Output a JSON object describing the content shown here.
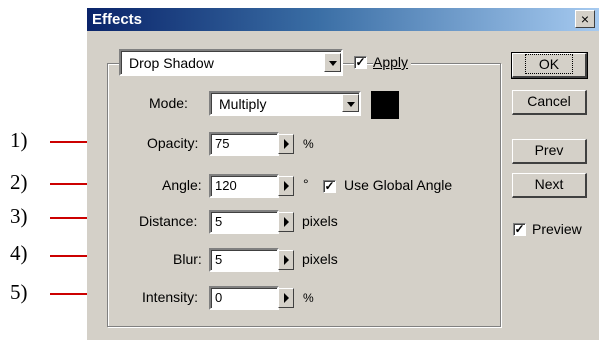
{
  "window": {
    "title": "Effects",
    "close_glyph": "×"
  },
  "effect": {
    "selected": "Drop Shadow",
    "apply_label": "Apply",
    "apply_checked": true
  },
  "mode": {
    "label": "Mode:",
    "value": "Multiply",
    "swatch_color": "#000000"
  },
  "fields": [
    {
      "label": "Opacity:",
      "value": "75",
      "unit": "%"
    },
    {
      "label": "Angle:",
      "value": "120",
      "unit": "°"
    },
    {
      "label": "Distance:",
      "value": "5",
      "unit": "pixels"
    },
    {
      "label": "Blur:",
      "value": "5",
      "unit": "pixels"
    },
    {
      "label": "Intensity:",
      "value": "0",
      "unit": "%"
    }
  ],
  "global_angle": {
    "label": "Use Global Angle",
    "checked": true
  },
  "buttons": {
    "ok": "OK",
    "cancel": "Cancel",
    "prev": "Prev",
    "next": "Next"
  },
  "preview": {
    "label": "Preview",
    "checked": true
  },
  "callouts": [
    "1)",
    "2)",
    "3)",
    "4)",
    "5)"
  ],
  "colors": {
    "callout_line": "#cc0000",
    "title_bar": "#0a246a"
  }
}
